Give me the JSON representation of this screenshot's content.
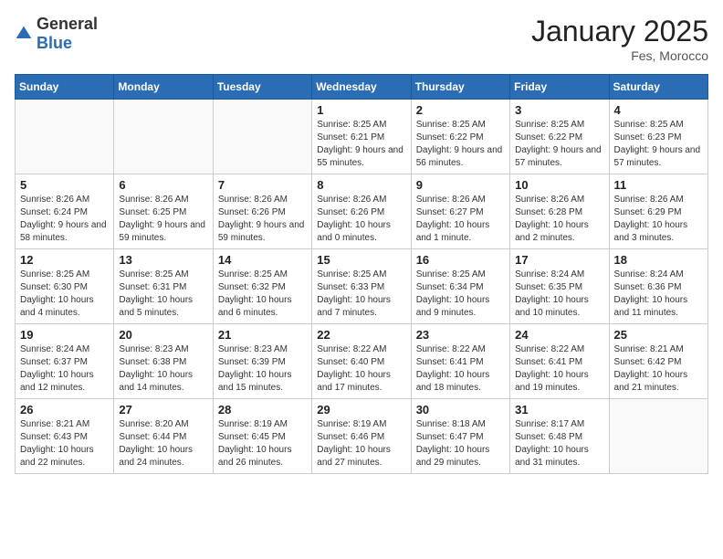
{
  "header": {
    "logo_general": "General",
    "logo_blue": "Blue",
    "month_year": "January 2025",
    "location": "Fes, Morocco"
  },
  "days_of_week": [
    "Sunday",
    "Monday",
    "Tuesday",
    "Wednesday",
    "Thursday",
    "Friday",
    "Saturday"
  ],
  "weeks": [
    [
      {
        "day": "",
        "info": ""
      },
      {
        "day": "",
        "info": ""
      },
      {
        "day": "",
        "info": ""
      },
      {
        "day": "1",
        "info": "Sunrise: 8:25 AM\nSunset: 6:21 PM\nDaylight: 9 hours and 55 minutes."
      },
      {
        "day": "2",
        "info": "Sunrise: 8:25 AM\nSunset: 6:22 PM\nDaylight: 9 hours and 56 minutes."
      },
      {
        "day": "3",
        "info": "Sunrise: 8:25 AM\nSunset: 6:22 PM\nDaylight: 9 hours and 57 minutes."
      },
      {
        "day": "4",
        "info": "Sunrise: 8:25 AM\nSunset: 6:23 PM\nDaylight: 9 hours and 57 minutes."
      }
    ],
    [
      {
        "day": "5",
        "info": "Sunrise: 8:26 AM\nSunset: 6:24 PM\nDaylight: 9 hours and 58 minutes."
      },
      {
        "day": "6",
        "info": "Sunrise: 8:26 AM\nSunset: 6:25 PM\nDaylight: 9 hours and 59 minutes."
      },
      {
        "day": "7",
        "info": "Sunrise: 8:26 AM\nSunset: 6:26 PM\nDaylight: 9 hours and 59 minutes."
      },
      {
        "day": "8",
        "info": "Sunrise: 8:26 AM\nSunset: 6:26 PM\nDaylight: 10 hours and 0 minutes."
      },
      {
        "day": "9",
        "info": "Sunrise: 8:26 AM\nSunset: 6:27 PM\nDaylight: 10 hours and 1 minute."
      },
      {
        "day": "10",
        "info": "Sunrise: 8:26 AM\nSunset: 6:28 PM\nDaylight: 10 hours and 2 minutes."
      },
      {
        "day": "11",
        "info": "Sunrise: 8:26 AM\nSunset: 6:29 PM\nDaylight: 10 hours and 3 minutes."
      }
    ],
    [
      {
        "day": "12",
        "info": "Sunrise: 8:25 AM\nSunset: 6:30 PM\nDaylight: 10 hours and 4 minutes."
      },
      {
        "day": "13",
        "info": "Sunrise: 8:25 AM\nSunset: 6:31 PM\nDaylight: 10 hours and 5 minutes."
      },
      {
        "day": "14",
        "info": "Sunrise: 8:25 AM\nSunset: 6:32 PM\nDaylight: 10 hours and 6 minutes."
      },
      {
        "day": "15",
        "info": "Sunrise: 8:25 AM\nSunset: 6:33 PM\nDaylight: 10 hours and 7 minutes."
      },
      {
        "day": "16",
        "info": "Sunrise: 8:25 AM\nSunset: 6:34 PM\nDaylight: 10 hours and 9 minutes."
      },
      {
        "day": "17",
        "info": "Sunrise: 8:24 AM\nSunset: 6:35 PM\nDaylight: 10 hours and 10 minutes."
      },
      {
        "day": "18",
        "info": "Sunrise: 8:24 AM\nSunset: 6:36 PM\nDaylight: 10 hours and 11 minutes."
      }
    ],
    [
      {
        "day": "19",
        "info": "Sunrise: 8:24 AM\nSunset: 6:37 PM\nDaylight: 10 hours and 12 minutes."
      },
      {
        "day": "20",
        "info": "Sunrise: 8:23 AM\nSunset: 6:38 PM\nDaylight: 10 hours and 14 minutes."
      },
      {
        "day": "21",
        "info": "Sunrise: 8:23 AM\nSunset: 6:39 PM\nDaylight: 10 hours and 15 minutes."
      },
      {
        "day": "22",
        "info": "Sunrise: 8:22 AM\nSunset: 6:40 PM\nDaylight: 10 hours and 17 minutes."
      },
      {
        "day": "23",
        "info": "Sunrise: 8:22 AM\nSunset: 6:41 PM\nDaylight: 10 hours and 18 minutes."
      },
      {
        "day": "24",
        "info": "Sunrise: 8:22 AM\nSunset: 6:41 PM\nDaylight: 10 hours and 19 minutes."
      },
      {
        "day": "25",
        "info": "Sunrise: 8:21 AM\nSunset: 6:42 PM\nDaylight: 10 hours and 21 minutes."
      }
    ],
    [
      {
        "day": "26",
        "info": "Sunrise: 8:21 AM\nSunset: 6:43 PM\nDaylight: 10 hours and 22 minutes."
      },
      {
        "day": "27",
        "info": "Sunrise: 8:20 AM\nSunset: 6:44 PM\nDaylight: 10 hours and 24 minutes."
      },
      {
        "day": "28",
        "info": "Sunrise: 8:19 AM\nSunset: 6:45 PM\nDaylight: 10 hours and 26 minutes."
      },
      {
        "day": "29",
        "info": "Sunrise: 8:19 AM\nSunset: 6:46 PM\nDaylight: 10 hours and 27 minutes."
      },
      {
        "day": "30",
        "info": "Sunrise: 8:18 AM\nSunset: 6:47 PM\nDaylight: 10 hours and 29 minutes."
      },
      {
        "day": "31",
        "info": "Sunrise: 8:17 AM\nSunset: 6:48 PM\nDaylight: 10 hours and 31 minutes."
      },
      {
        "day": "",
        "info": ""
      }
    ]
  ]
}
